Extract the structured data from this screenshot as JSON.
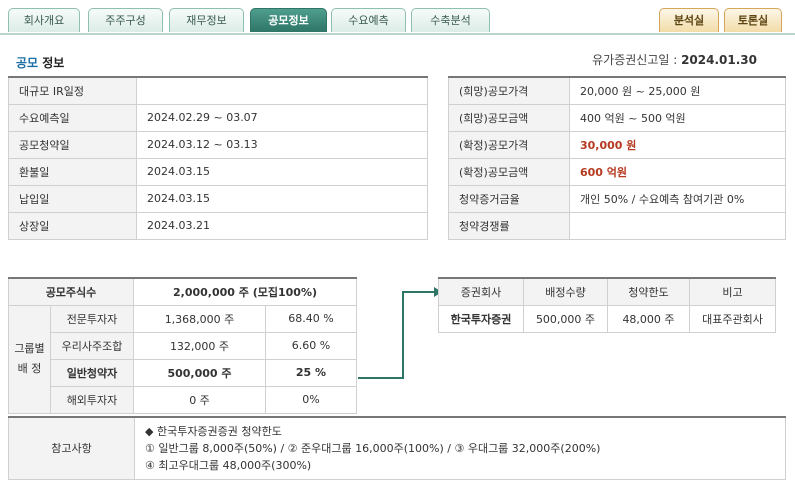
{
  "tabs": [
    "회사개요",
    "주주구성",
    "재무정보",
    "공모정보",
    "수요예측",
    "수축분석"
  ],
  "right_tabs": [
    "분석실",
    "토론실"
  ],
  "section_title": {
    "highlight": "공모",
    "rest": " 정보"
  },
  "filing": {
    "label": "유가증권신고일 : ",
    "date": "2024.01.30"
  },
  "schedule": [
    {
      "label": "대규모 IR일정",
      "value": ""
    },
    {
      "label": "수요예측일",
      "value": "2024.02.29 ~ 03.07"
    },
    {
      "label": "공모청약일",
      "value": "2024.03.12 ~ 03.13"
    },
    {
      "label": "환불일",
      "value": "2024.03.15"
    },
    {
      "label": "납입일",
      "value": "2024.03.15"
    },
    {
      "label": "상장일",
      "value": "2024.03.21"
    }
  ],
  "pricing": [
    {
      "label": "(희망)공모가격",
      "value": "20,000 원 ~ 25,000 원"
    },
    {
      "label": "(희망)공모금액",
      "value": "400 억원  ~  500 억원"
    },
    {
      "label": "(확정)공모가격",
      "value": "30,000 원"
    },
    {
      "label": "(확정)공모금액",
      "value": "600 억원"
    },
    {
      "label": "청약증거금율",
      "value": "개인 50% / 수요예측 참여기관 0%"
    },
    {
      "label": "청약경쟁률",
      "value": ""
    }
  ],
  "allocation": {
    "header_label": "공모주식수",
    "header_value": "2,000,000 주 (모집100%)",
    "group_label_1": "그룹별",
    "group_label_2": "배  정",
    "rows": [
      {
        "name": "전문투자자",
        "shares": "1,368,000 주",
        "pct": "68.40 %"
      },
      {
        "name": "우리사주조합",
        "shares": "132,000 주",
        "pct": "6.60 %"
      },
      {
        "name": "일반청약자",
        "shares": "500,000 주",
        "pct": "25 %"
      },
      {
        "name": "해외투자자",
        "shares": "0 주",
        "pct": "0%"
      }
    ]
  },
  "underwriter": {
    "headers": [
      "증권회사",
      "배정수량",
      "청약한도",
      "비고"
    ],
    "row": [
      "한국투자증권",
      "500,000 주",
      "48,000 주",
      "대표주관회사"
    ]
  },
  "notes": {
    "label": "참고사항",
    "line1": "◆ 한국투자증권증권 청약한도",
    "line2": "① 일반그룹 8,000주(50%) / ② 준우대그룹 16,000주(100%) / ③ 우대그룹 32,000주(200%)",
    "line3": "④ 최고우대그룹 48,000주(300%)"
  },
  "colors": {
    "accent": "#2e7566",
    "highlight_red": "#b5391f",
    "title_blue": "#1b6fa6"
  }
}
